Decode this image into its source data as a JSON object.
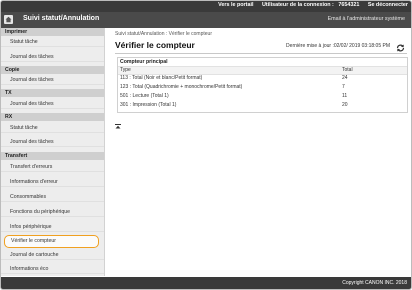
{
  "topbar": {
    "portal_link": "Vers le portail",
    "user_label": "Utilisateur de la connexion :",
    "user_id": "7654321",
    "logout": "Se déconnecter"
  },
  "header": {
    "title": "Suivi statut/Annulation",
    "email_link": "Email à l'administrateur système"
  },
  "sidebar": {
    "sections": [
      {
        "label": "Imprimer",
        "items": [
          "Statut tâche",
          "Journal des tâches"
        ]
      },
      {
        "label": "Copie",
        "items": [
          "Journal des tâches"
        ]
      },
      {
        "label": "TX",
        "items": [
          "Journal des tâches"
        ]
      },
      {
        "label": "RX",
        "items": [
          "Statut tâche",
          "Journal des tâches"
        ]
      },
      {
        "label": "Transfert",
        "items": [
          "Transfert d'erreurs",
          "Informations d'erreur",
          "Consommables",
          "Fonctions du périphérique",
          "Infos périphérique",
          "Vérifier le compteur",
          "Journal de cartouche",
          "Informations éco"
        ]
      }
    ]
  },
  "main": {
    "breadcrumb": "Suivi statut/Annulation : Vérifier le compteur",
    "title": "Vérifier le compteur",
    "last_update": "Dernière mise à jour :02/02/ 2019 03:18:05 PM",
    "panel_title": "Compteur principal",
    "col_type": "Type",
    "col_total": "Total",
    "rows": [
      {
        "type": "113 : Total (Noir et blanc/Petit format)",
        "total": "24"
      },
      {
        "type": "123 : Total (Quadrichromie + monochrome/Petit format)",
        "total": "7"
      },
      {
        "type": "501 : Lecture (Total 1)",
        "total": "11"
      },
      {
        "type": "301 : Impression (Total 1)",
        "total": "20"
      }
    ]
  },
  "footer": {
    "copyright": "Copyright CANON INC. 2018"
  },
  "colors": {
    "topbar": "#3a3a3a",
    "header": "#4a4a4a",
    "sidebar": "#ededed",
    "selected_outline": "#f0a020"
  }
}
